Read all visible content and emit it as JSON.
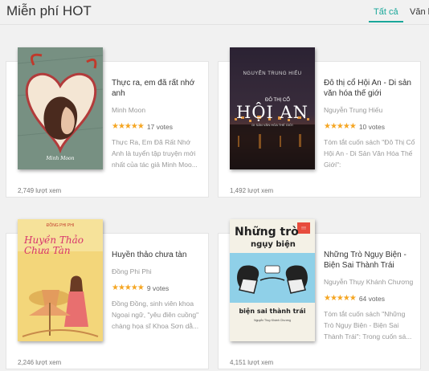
{
  "section": {
    "title": "Miễn phí HOT",
    "tabs": [
      "Tất cả",
      "Văn học"
    ]
  },
  "accent_color": "#1aa79a",
  "star_color": "#f5a623",
  "books": [
    {
      "title": "Thực ra, em đã rất nhớ anh",
      "author": "Minh Moon",
      "stars": "★★★★★",
      "votes": "17 votes",
      "description": "Thực Ra, Em Đã Rất Nhớ Anh là tuyển tập truyện mới nhất của tác giả Minh Moo...",
      "views": "2,749 lượt xem",
      "cover_text": "Thực ra, em đã rất nhớ anh"
    },
    {
      "title": "Đô thị cổ Hội An - Di sản văn hóa thế giới",
      "author": "Nguyễn Trung Hiếu",
      "stars": "★★★★★",
      "votes": "10 votes",
      "description": "Tóm tắt cuốn sách \"Đô Thị Cổ Hội An - Di Sản Văn Hóa Thế Giới\":",
      "views": "1,492 lượt xem",
      "cover_author": "NGUYỄN TRUNG HIẾU",
      "cover_top": "ĐÔ THỊ CỔ",
      "cover_main": "HỘI AN",
      "cover_sub": "DI SẢN VĂN HÓA THẾ GIỚI"
    },
    {
      "title": "Huyền thảo chưa tàn",
      "author": "Đồng Phi Phi",
      "stars": "★★★★★",
      "votes": "9 votes",
      "description": "Đồng Đồng, sinh viên khoa Ngoại ngữ, \"yêu điên cuồng\" chàng họa sĩ Khoa Sơn dằ...",
      "views": "2,246 lượt xem",
      "cover_author": "ĐỒNG PHI PHI",
      "cover_text": "Huyền Thảo Chưa Tàn"
    },
    {
      "title": "Những Trò Ngụy Biện - Biện Sai Thành Trái",
      "author": "Nguyễn Thụy Khánh Chương",
      "stars": "★★★★★",
      "votes": "64 votes",
      "description": "Tóm tắt cuốn sách \"Những Trò Ngụy Biện - Biện Sai Thành Trái\": Trong cuốn sá...",
      "views": "4,151 lượt xem",
      "cover_line1": "Những trò",
      "cover_line2": "ngụy biện",
      "cover_line3": "biện sai thành trái",
      "cover_author": "Nguyễn Thụy Khánh Chương"
    }
  ]
}
